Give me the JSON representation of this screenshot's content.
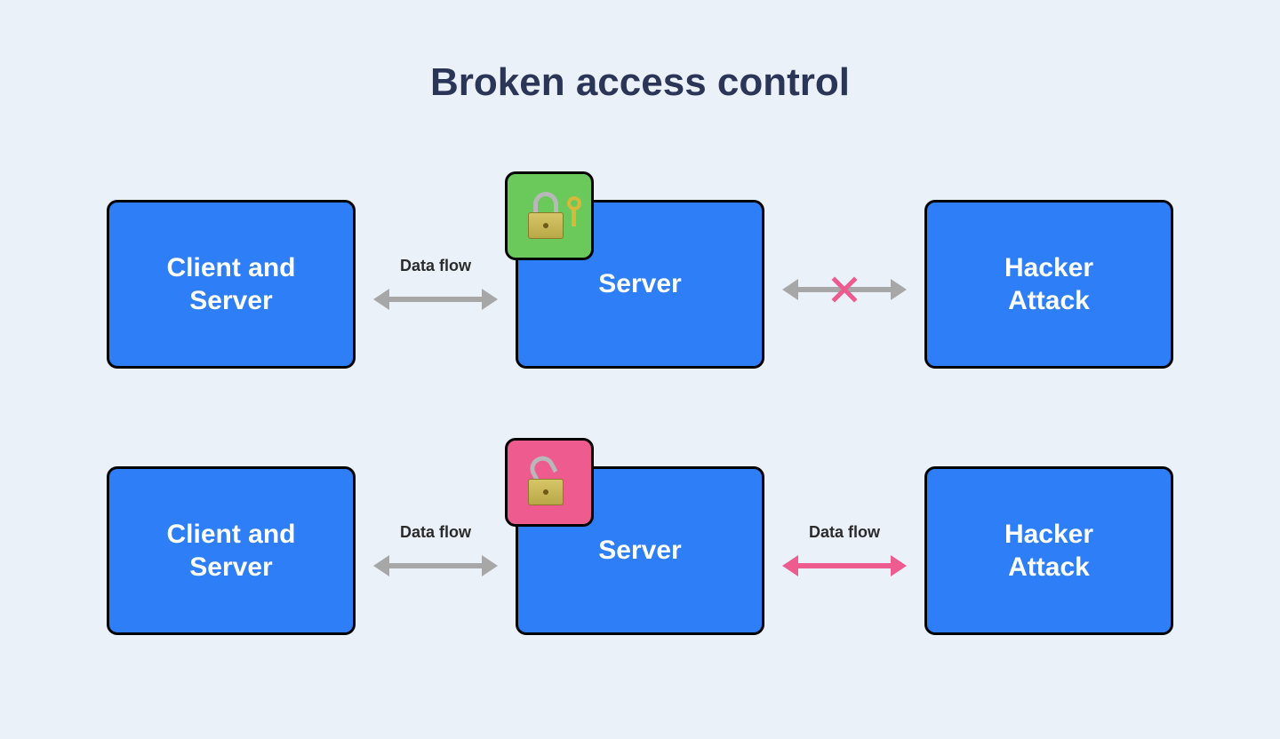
{
  "title": "Broken access control",
  "rows": [
    {
      "left_box": "Client and\nServer",
      "center_box": "Server",
      "right_box": "Hacker\nAttack",
      "conn_left_label": "Data flow",
      "conn_right_label": "",
      "lock_state": "locked",
      "lock_badge_color": "green",
      "right_arrow_color": "gray",
      "right_blocked": true
    },
    {
      "left_box": "Client and\nServer",
      "center_box": "Server",
      "right_box": "Hacker\nAttack",
      "conn_left_label": "Data flow",
      "conn_right_label": "Data flow",
      "lock_state": "open",
      "lock_badge_color": "pink",
      "right_arrow_color": "pink",
      "right_blocked": false
    }
  ],
  "colors": {
    "box_fill": "#2d7ef7",
    "title": "#2a3558",
    "bg": "#ebf1f9",
    "gray_arrow": "#a7a7a7",
    "pink": "#ed5b8f",
    "green": "#6bc95c"
  }
}
